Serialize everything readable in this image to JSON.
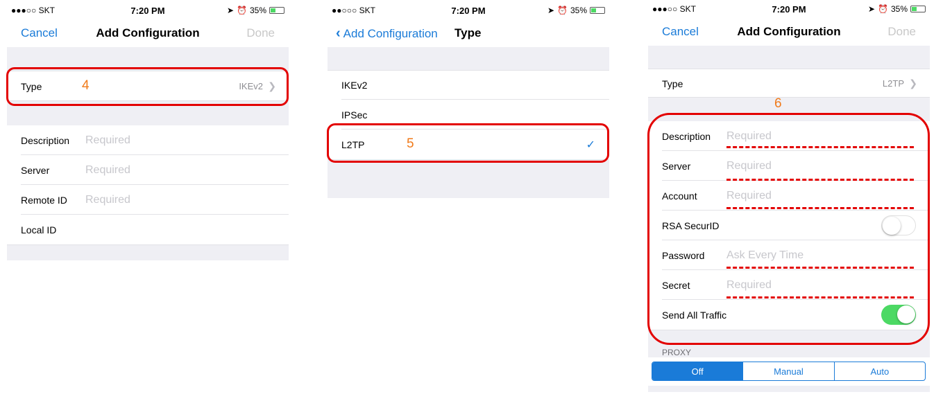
{
  "status_bar": {
    "carrier": "●●●○○ SKT",
    "carrier_2": "●●○○○ SKT",
    "time": "7:20 PM",
    "battery": "35%",
    "battery_level": 0.35
  },
  "screen1": {
    "nav": {
      "cancel": "Cancel",
      "title": "Add Configuration",
      "done": "Done"
    },
    "type_row": {
      "label": "Type",
      "value": "IKEv2"
    },
    "annotation": "4",
    "fields": [
      {
        "label": "Description",
        "placeholder": "Required"
      },
      {
        "label": "Server",
        "placeholder": "Required"
      },
      {
        "label": "Remote ID",
        "placeholder": "Required"
      },
      {
        "label": "Local ID",
        "placeholder": ""
      }
    ]
  },
  "screen2": {
    "nav": {
      "back": "Add Configuration",
      "title": "Type"
    },
    "options": [
      "IKEv2",
      "IPSec",
      "L2TP"
    ],
    "selected": "L2TP",
    "annotation": "5"
  },
  "screen3": {
    "nav": {
      "cancel": "Cancel",
      "title": "Add Configuration",
      "done": "Done"
    },
    "type_row": {
      "label": "Type",
      "value": "L2TP"
    },
    "annotation": "6",
    "fields": [
      {
        "label": "Description",
        "placeholder": "Required"
      },
      {
        "label": "Server",
        "placeholder": "Required"
      },
      {
        "label": "Account",
        "placeholder": "Required"
      },
      {
        "label": "RSA SecurID",
        "toggle": false
      },
      {
        "label": "Password",
        "placeholder": "Ask Every Time"
      },
      {
        "label": "Secret",
        "placeholder": "Required"
      },
      {
        "label": "Send All Traffic",
        "toggle": true
      }
    ],
    "proxy": {
      "header": "PROXY",
      "options": [
        "Off",
        "Manual",
        "Auto"
      ],
      "selected": "Off"
    }
  },
  "colors": {
    "accent": "#1a7bd8",
    "annotation_red": "#e30000",
    "annotation_orange": "#f07a1a",
    "toggle_on": "#4cd964",
    "group_bg": "#efeff4"
  }
}
